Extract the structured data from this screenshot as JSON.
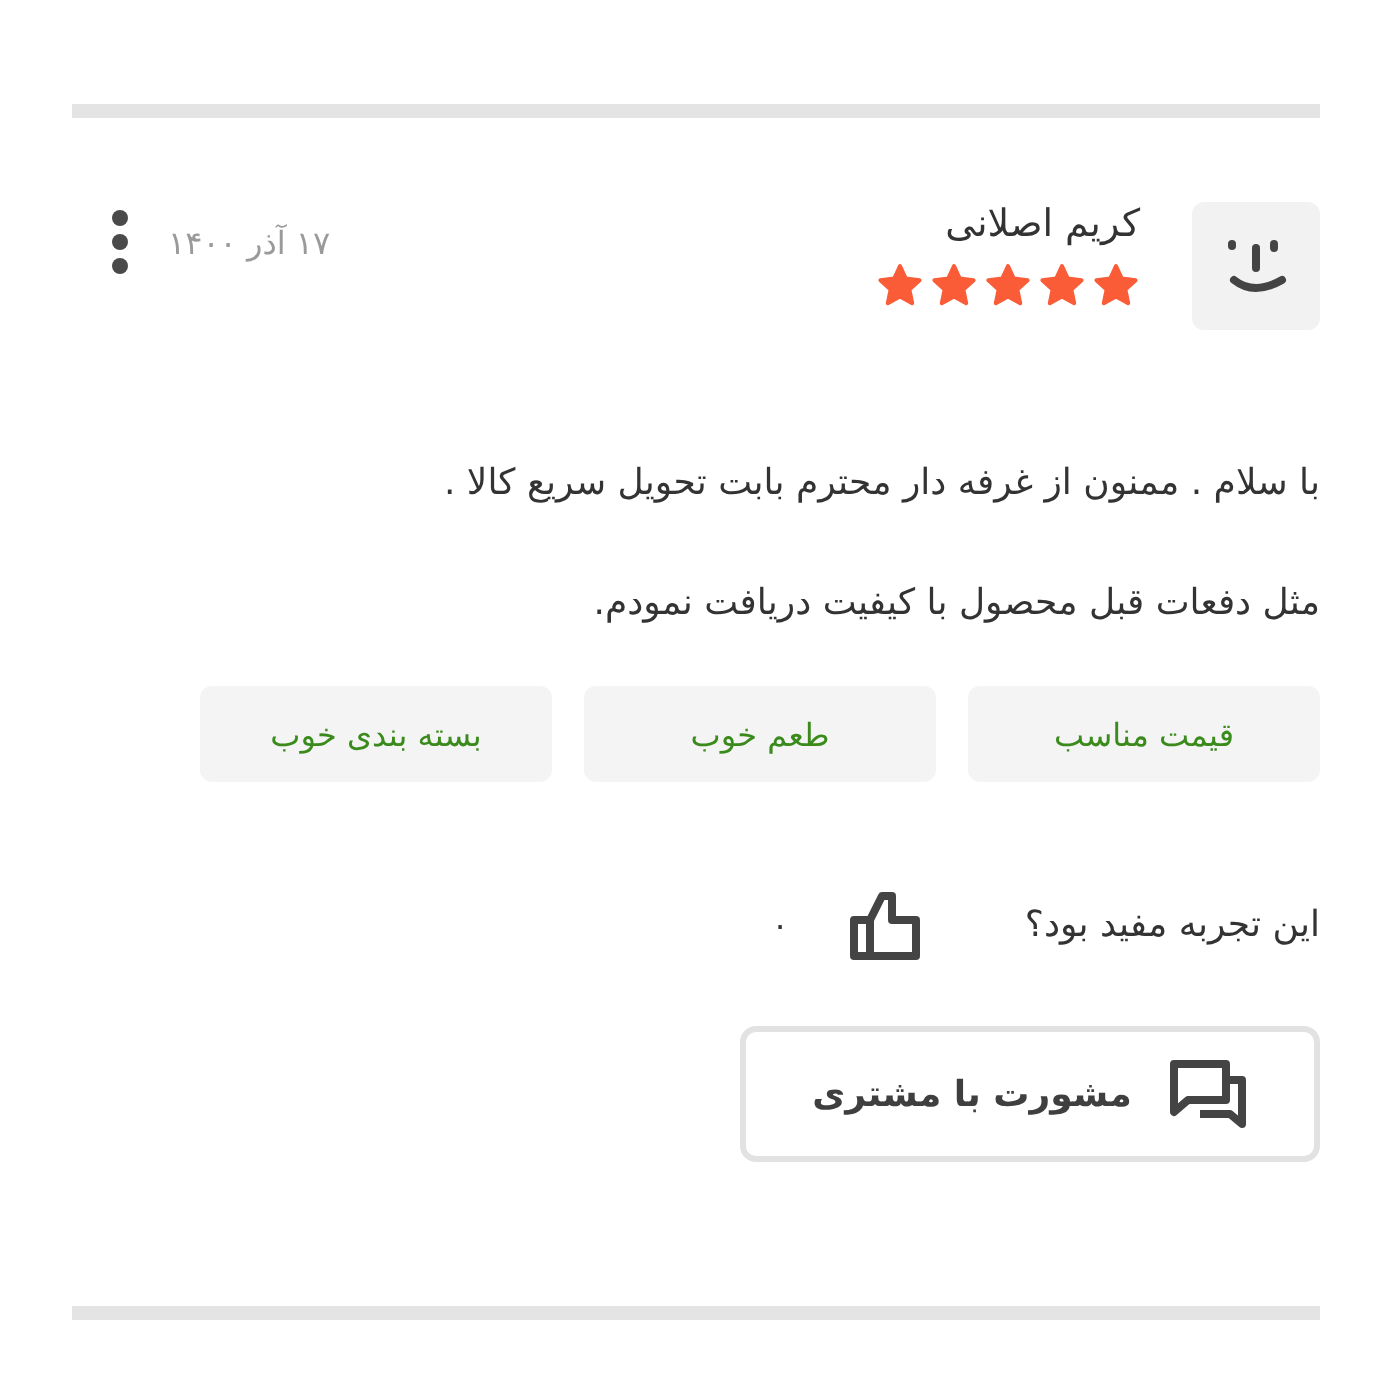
{
  "review": {
    "author": "کریم اصلانی",
    "stars": 5,
    "date": "۱۷ آذر ۱۴۰۰",
    "paragraphs": [
      "با سلام . ممنون از غرفه دار محترم بابت تحویل سریع کالا .",
      "مثل دفعات قبل محصول با کیفیت دریافت نمودم."
    ],
    "tags": [
      "قیمت مناسب",
      "طعم خوب",
      "بسته بندی خوب"
    ],
    "helpful": {
      "question": "این تجربه مفید بود؟",
      "count": "۰"
    },
    "button": "مشورت با مشتری"
  }
}
